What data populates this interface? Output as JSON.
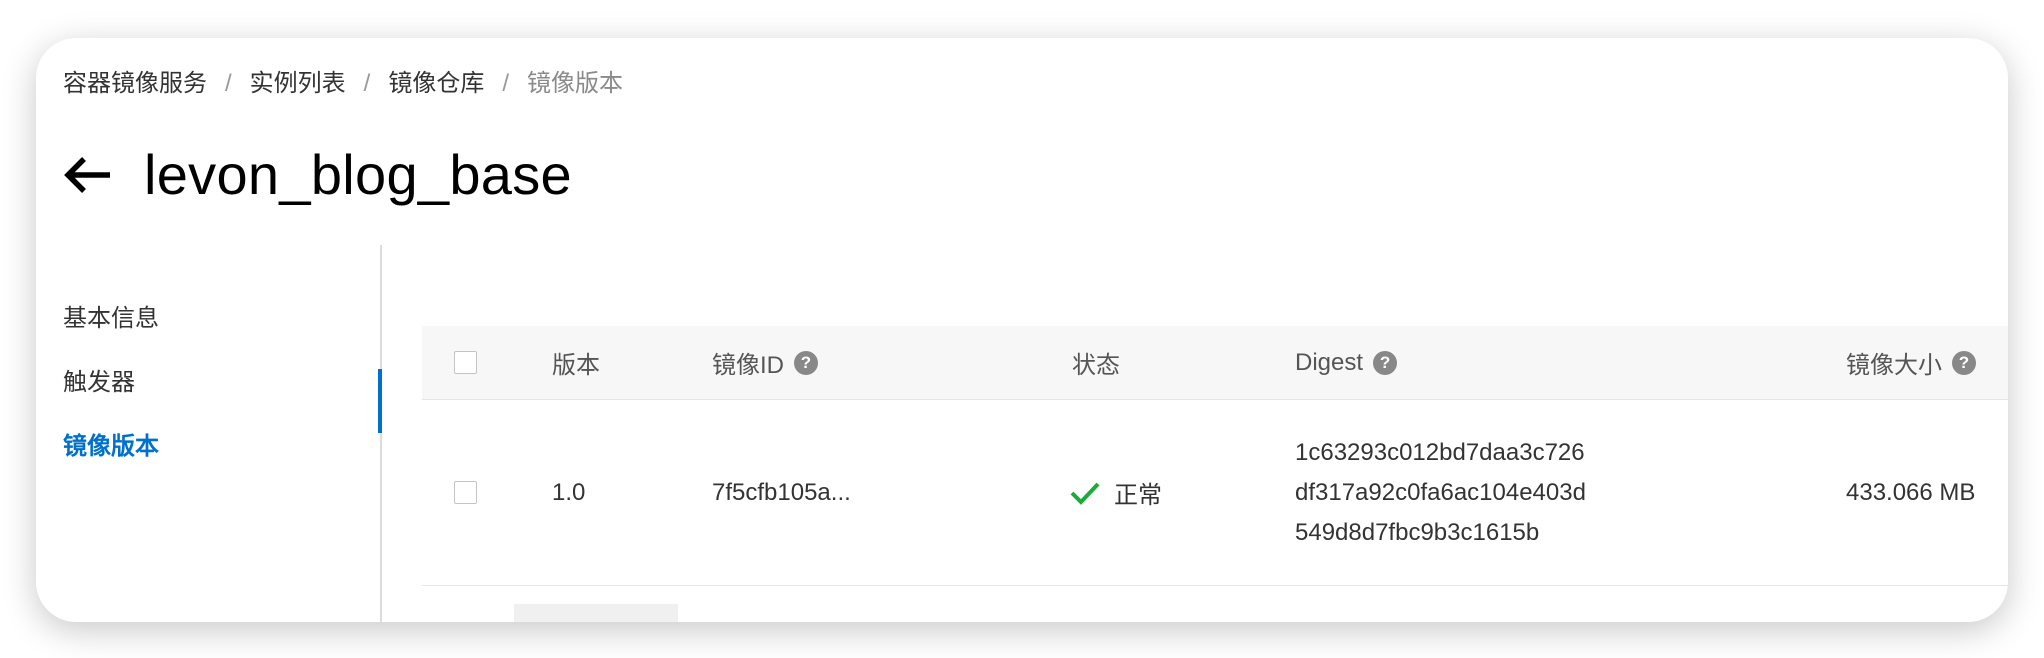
{
  "breadcrumb": {
    "items": [
      "容器镜像服务",
      "实例列表",
      "镜像仓库"
    ],
    "current": "镜像版本",
    "separator": "/"
  },
  "title": "levon_blog_base",
  "sidenav": {
    "items": [
      {
        "label": "基本信息",
        "active": false
      },
      {
        "label": "触发器",
        "active": false
      },
      {
        "label": "镜像版本",
        "active": true
      }
    ],
    "active_color": "#0070cc"
  },
  "table": {
    "columns": {
      "version": "版本",
      "image_id": "镜像ID",
      "status": "状态",
      "digest": "Digest",
      "size": "镜像大小"
    },
    "rows": [
      {
        "version": "1.0",
        "image_id": "7f5cfb105a...",
        "status": "正常",
        "digest_lines": [
          "1c63293c012bd7daa3c726",
          "df317a92c0fa6ac104e403d",
          "549d8d7fbc9b3c1615b"
        ],
        "size": "433.066 MB"
      }
    ]
  },
  "icons": {
    "back": "arrow-left-icon",
    "help": "question-circle-icon",
    "status_ok": "check-icon"
  },
  "colors": {
    "success": "#1aab38",
    "link": "#0070cc"
  }
}
